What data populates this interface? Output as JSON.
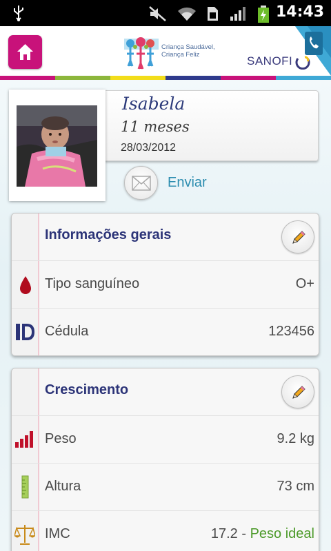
{
  "status_bar": {
    "time": "14:43",
    "icons": [
      "usb-icon",
      "mute-icon",
      "wifi-icon",
      "sim-icon",
      "signal-icon",
      "battery-charging-icon"
    ]
  },
  "header": {
    "home_icon": "home-icon",
    "logo_line1": "Criança Saudável,",
    "logo_line2": "Criança Feliz",
    "brand": "SANOFI",
    "phone_icon": "phone-icon",
    "brand_colors": [
      "#c8127a",
      "#8cb63c",
      "#f2dd1a",
      "#2f3a8c",
      "#c8127a",
      "#3fa9d6"
    ]
  },
  "profile": {
    "name": "Isabela",
    "age": "11 meses",
    "birth_date": "28/03/2012",
    "send_label": "Enviar",
    "send_icon": "envelope-icon"
  },
  "general_info": {
    "title": "Informações gerais",
    "edit_icon": "pencil-icon",
    "rows": [
      {
        "icon": "blood-drop-icon",
        "label": "Tipo sanguíneo",
        "value": "O+"
      },
      {
        "icon": "id-card-icon",
        "label": "Cédula",
        "value": "123456"
      }
    ]
  },
  "growth": {
    "title": "Crescimento",
    "edit_icon": "pencil-icon",
    "rows": [
      {
        "icon": "weight-bars-icon",
        "label": "Peso",
        "value": "9.2 kg"
      },
      {
        "icon": "ruler-icon",
        "label": "Altura",
        "value": "73 cm"
      },
      {
        "icon": "scale-icon",
        "label": "IMC",
        "value": "17.2",
        "separator": " - ",
        "status": "Peso ideal"
      }
    ]
  }
}
